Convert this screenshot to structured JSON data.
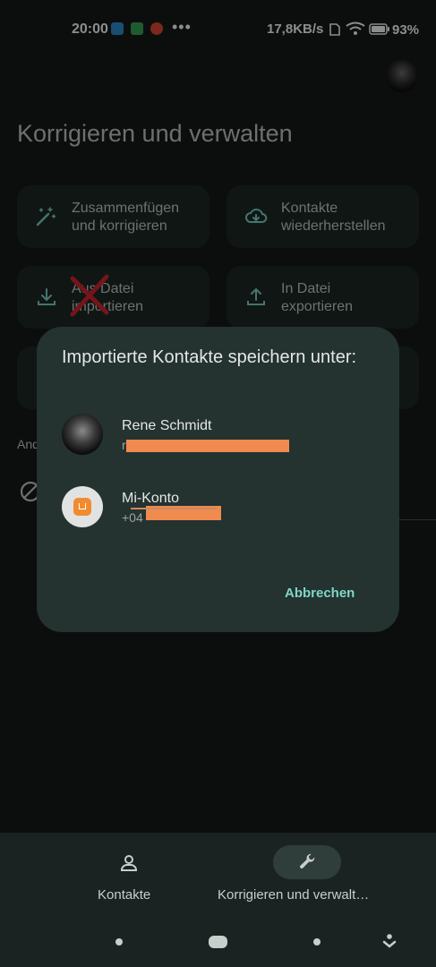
{
  "status_bar": {
    "time": "20:00",
    "dots": "•••",
    "speed": "17,8KB/s",
    "battery": "93%"
  },
  "page": {
    "title": "Korrigieren und verwalten",
    "section_label": "And"
  },
  "cards": [
    {
      "label": "Zusammenfügen\nund korrigieren",
      "icon": "magic-wand-icon"
    },
    {
      "label": "Kontakte\nwiederherstellen",
      "icon": "cloud-restore-icon"
    },
    {
      "label": "Aus Datei\nimportieren",
      "icon": "download-icon"
    },
    {
      "label": "In Datei\nexportieren",
      "icon": "upload-icon"
    }
  ],
  "dialog": {
    "title": "Importierte Kontakte speichern unter:",
    "accounts": [
      {
        "name": "Rene Schmidt",
        "sub": "r"
      },
      {
        "name": "Mi-Konto",
        "sub": "+04"
      }
    ],
    "cancel_label": "Abbrechen"
  },
  "bottom_nav": {
    "contacts_label": "Kontakte",
    "manage_label": "Korrigieren und verwalt…"
  },
  "colors": {
    "background": "#161a19",
    "card": "#1e2826",
    "dialog": "#243230",
    "accent": "#7fd6c8",
    "redaction": "#f08a4f",
    "annotation_x": "#d6262e"
  }
}
